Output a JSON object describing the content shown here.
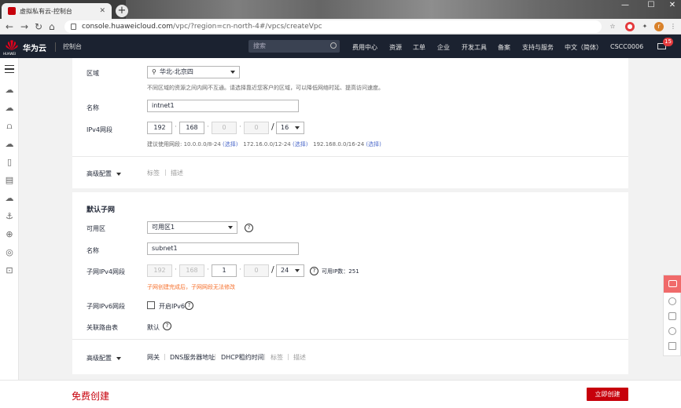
{
  "browser": {
    "tab_title": "虚拟私有云-控制台",
    "url_host": "console.huaweicloud.com",
    "url_path": "/vpc/?region=cn-north-4#/vpcs/createVpc"
  },
  "header": {
    "logo_caption": "HUAWEI",
    "brand": "华为云",
    "console": "控制台",
    "search_placeholder": "搜索",
    "nav": [
      "费用中心",
      "资源",
      "工单",
      "企业",
      "开发工具",
      "备案",
      "支持与服务",
      "中文（简体）",
      "CSCC0006"
    ],
    "mail_count": "15"
  },
  "vpc": {
    "region_label": "区域",
    "region_value": "华北-北京四",
    "region_hint": "不同区域的资源之间内网不互通。请选择靠近您客户的区域，可以降低网络时延、提高访问速度。",
    "name_label": "名称",
    "name_value": "intnet1",
    "ipv4_label": "IPv4网段",
    "ip": [
      "192",
      "168",
      "0",
      "0"
    ],
    "mask": "16",
    "suggest_prefix": "建议使用网段: ",
    "suggest": [
      {
        "range": "10.0.0.0/8-24",
        "select": "(选择)"
      },
      {
        "range": "172.16.0.0/12-24",
        "select": "(选择)"
      },
      {
        "range": "192.168.0.0/16-24",
        "select": "(选择)"
      }
    ],
    "advanced_label": "高级配置",
    "advanced_tabs": [
      "标签",
      "描述"
    ]
  },
  "subnet": {
    "section_title": "默认子网",
    "az_label": "可用区",
    "az_value": "可用区1",
    "name_label": "名称",
    "name_value": "subnet1",
    "ipv4_label": "子网IPv4网段",
    "ip": [
      "192",
      "168",
      "1",
      "0"
    ],
    "mask": "24",
    "available_ip": "可用IP数：251",
    "warn": "子网创建完成后，子网网段无法修改",
    "ipv6_label": "子网IPv6网段",
    "ipv6_checkbox": "开启IPv6",
    "route_label": "关联路由表",
    "route_value": "默认",
    "advanced_label": "高级配置",
    "advanced_tabs": [
      "网关",
      "DNS服务器地址",
      "DHCP租约时间",
      "标签",
      "描述"
    ]
  },
  "footer": {
    "free_text": "免费创建",
    "create_button": "立即创建"
  },
  "colors": {
    "brand_red": "#c7000b",
    "link_blue": "#526ecc",
    "warning_orange": "#f66f2b",
    "header_bg": "#1b2230"
  }
}
